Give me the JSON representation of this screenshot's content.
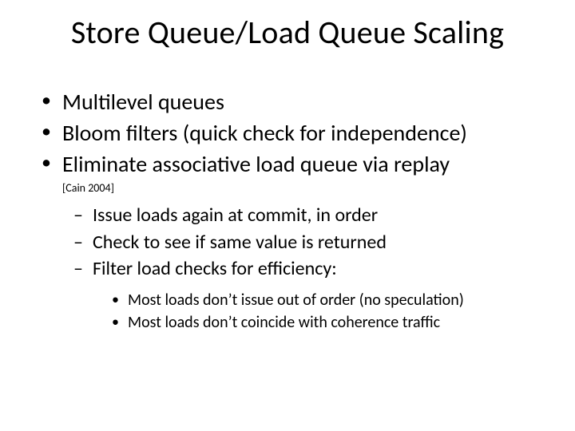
{
  "title": "Store Queue/Load Queue Scaling",
  "bullets": {
    "b1": "Multilevel queues",
    "b2": "Bloom filters (quick check for independence)",
    "b3": "Eliminate associative load queue via replay"
  },
  "citation": "[Cain 2004]",
  "sub": {
    "s1": "Issue loads again at commit, in order",
    "s2": "Check to see if same value is returned",
    "s3": "Filter load checks for efficiency:"
  },
  "sub2": {
    "d1": "Most loads don’t issue out of order (no speculation)",
    "d2": "Most loads don’t coincide with coherence traffic"
  }
}
